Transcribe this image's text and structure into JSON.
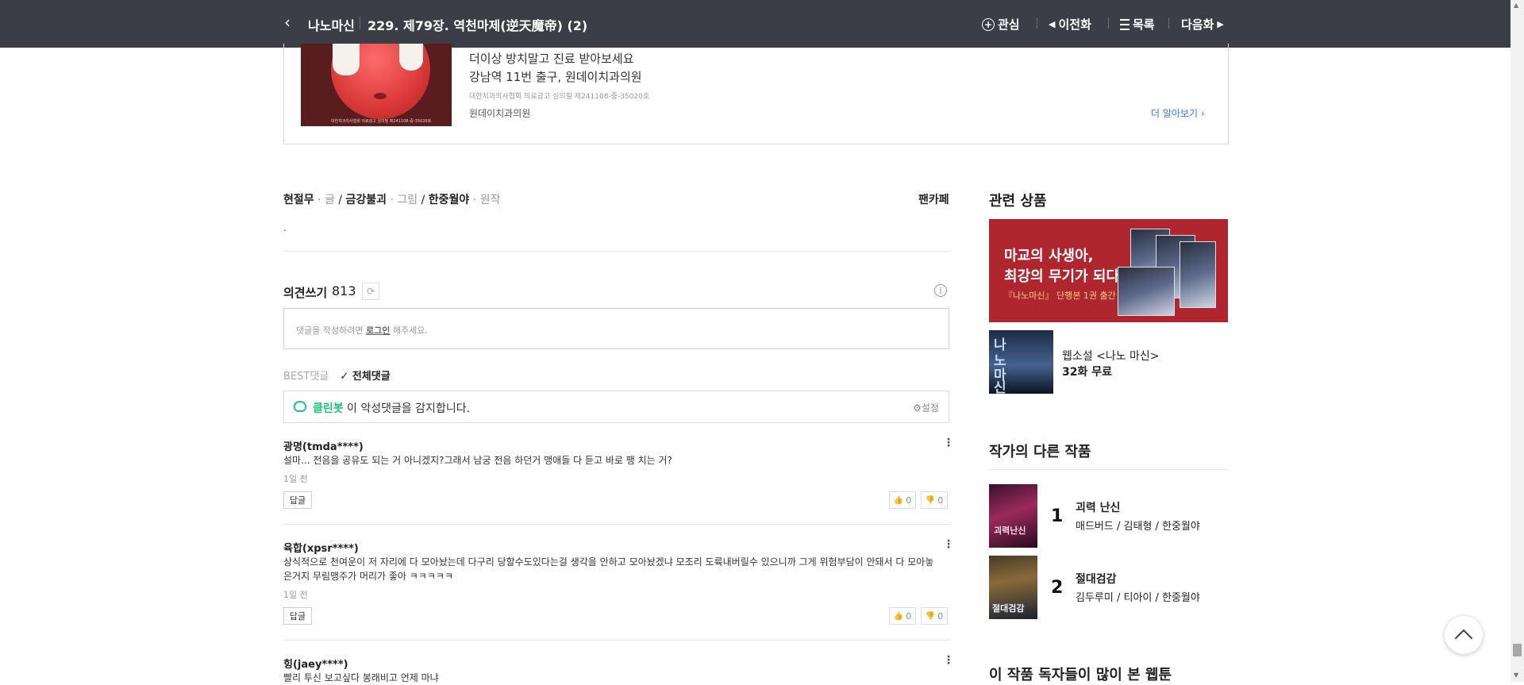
{
  "topbar": {
    "back_label": "‹",
    "series_title": "나노마신",
    "episode_title": "229. 제79장. 역천마제(逆天魔帝) (2)",
    "interest_label": "관심",
    "prev_label": "이전화",
    "list_label": "목록",
    "next_label": "다음화"
  },
  "ad": {
    "line1": "더이상 방치말고 진료 받아보세요",
    "line2": "강남역 11번 출구, 원데이치과의원",
    "notice": "대한치과의사협회 의료광고 심의필 제241108-중-35020호",
    "advertiser": "원데이치과의원",
    "more_label": "더 알아보기 ›",
    "image_fine_print": "대한치과의사협회 의료광고 심의필 제241108-중-35020호"
  },
  "credits": {
    "writer": "현절무",
    "writer_role": "글",
    "artist": "금강불괴",
    "artist_role": "그림",
    "original": "한중월야",
    "original_role": "원작",
    "fancafe": "팬카페",
    "note": "."
  },
  "comments": {
    "title": "의견쓰기",
    "count": "813",
    "placeholder_prefix": "댓글을 작성하려면 ",
    "placeholder_link": "로그인",
    "placeholder_suffix": " 해주세요.",
    "tab_best": "BEST댓글",
    "tab_all": "전체댓글",
    "cleanbot_name": "클린봇",
    "cleanbot_text": "이 악성댓글을 감지합니다.",
    "cleanbot_settings": "설정",
    "items": [
      {
        "user": "광명(tmda****)",
        "text": "설마... 전음을 공유도 되는 거 아니겠지?그래서 남궁 전음 하던거 맹애들 다 듣고 바로 팽 치는 거?",
        "date": "1일 전",
        "reply": "답글",
        "likes": "0",
        "dislikes": "0"
      },
      {
        "user": "육합(xpsr****)",
        "text": "상식적으로 천여운이 저 자리에 다 모아놨는데 다구리 당할수도있다는걸 생각을 안하고 모아놨겠냐 모조리 도륙내버릴수 있으니까 그게 위험부담이 안돼서 다 모아놓은거지 무림맹주가 머리가 좋아 ㅋㅋㅋㅋㅋ",
        "date": "1일 전",
        "reply": "답글",
        "likes": "0",
        "dislikes": "0"
      },
      {
        "user": "힝(jaey****)",
        "text": "빨리 투신 보고싶다 봉래비고 언제 마냐",
        "date": "",
        "reply": "",
        "likes": "",
        "dislikes": ""
      }
    ]
  },
  "sidebar": {
    "related_title": "관련 상품",
    "banner_line1": "마교의 사생아,",
    "banner_line2": "최강의 무기가 되다!",
    "banner_line3": "『나노마신』 단행본 1권 출간",
    "product_thumb_text": "나노마신",
    "product_name": "웹소설 <나노 마신>",
    "product_free": "32화 무료",
    "other_works_title": "작가의 다른 작품",
    "works": [
      {
        "rank": "1",
        "title": "괴력 난신",
        "authors": "매드버드 / 김태형 / 한중월야",
        "thumb_text": "괴력난신"
      },
      {
        "rank": "2",
        "title": "절대검감",
        "authors": "김두루미 / 티아이 / 한중월야",
        "thumb_text": "절대검감"
      }
    ],
    "readers_title": "이 작품 독자들이 많이 본 웹툰"
  },
  "colors": {
    "topbar_bg": "#3b3e46",
    "link_blue": "#2f7be5",
    "cleanbot_green": "#1ec27c",
    "banner_red": "#b0262e"
  }
}
